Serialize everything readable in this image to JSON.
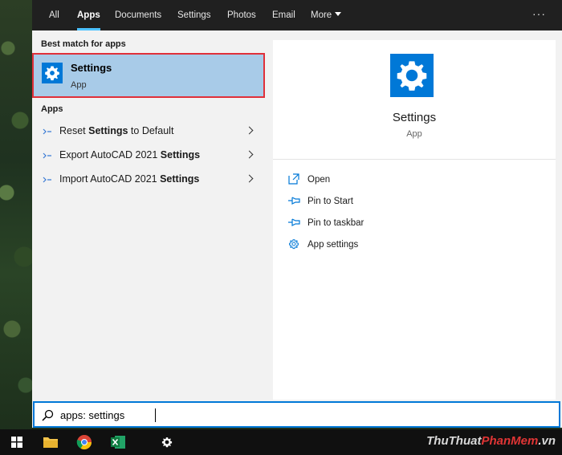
{
  "tabs": [
    {
      "label": "All",
      "active": false
    },
    {
      "label": "Apps",
      "active": true
    },
    {
      "label": "Documents",
      "active": false
    },
    {
      "label": "Settings",
      "active": false
    },
    {
      "label": "Photos",
      "active": false
    },
    {
      "label": "Email",
      "active": false
    },
    {
      "label": "More",
      "active": false
    }
  ],
  "more_menu_icon": "ellipsis-icon",
  "best_match": {
    "heading": "Best match for apps",
    "title": "Settings",
    "subtitle": "App",
    "icon": "gear-icon"
  },
  "apps": {
    "heading": "Apps",
    "items": [
      {
        "prefix": "Reset ",
        "bold": "Settings",
        "suffix": " to Default"
      },
      {
        "prefix": "Export AutoCAD 2021 ",
        "bold": "Settings",
        "suffix": ""
      },
      {
        "prefix": "Import AutoCAD 2021 ",
        "bold": "Settings",
        "suffix": ""
      }
    ]
  },
  "preview": {
    "title": "Settings",
    "subtitle": "App",
    "actions": [
      {
        "label": "Open",
        "icon": "open-icon"
      },
      {
        "label": "Pin to Start",
        "icon": "pin-icon"
      },
      {
        "label": "Pin to taskbar",
        "icon": "pin-icon"
      },
      {
        "label": "App settings",
        "icon": "gear-icon"
      }
    ]
  },
  "search": {
    "value": "apps: settings"
  },
  "watermark": {
    "part1": "ThuThuat",
    "part2": "PhanMem",
    "part3": ".vn"
  },
  "colors": {
    "accent": "#0078d7",
    "selected": "#a8cbe8",
    "highlight_border": "#e0303a"
  }
}
